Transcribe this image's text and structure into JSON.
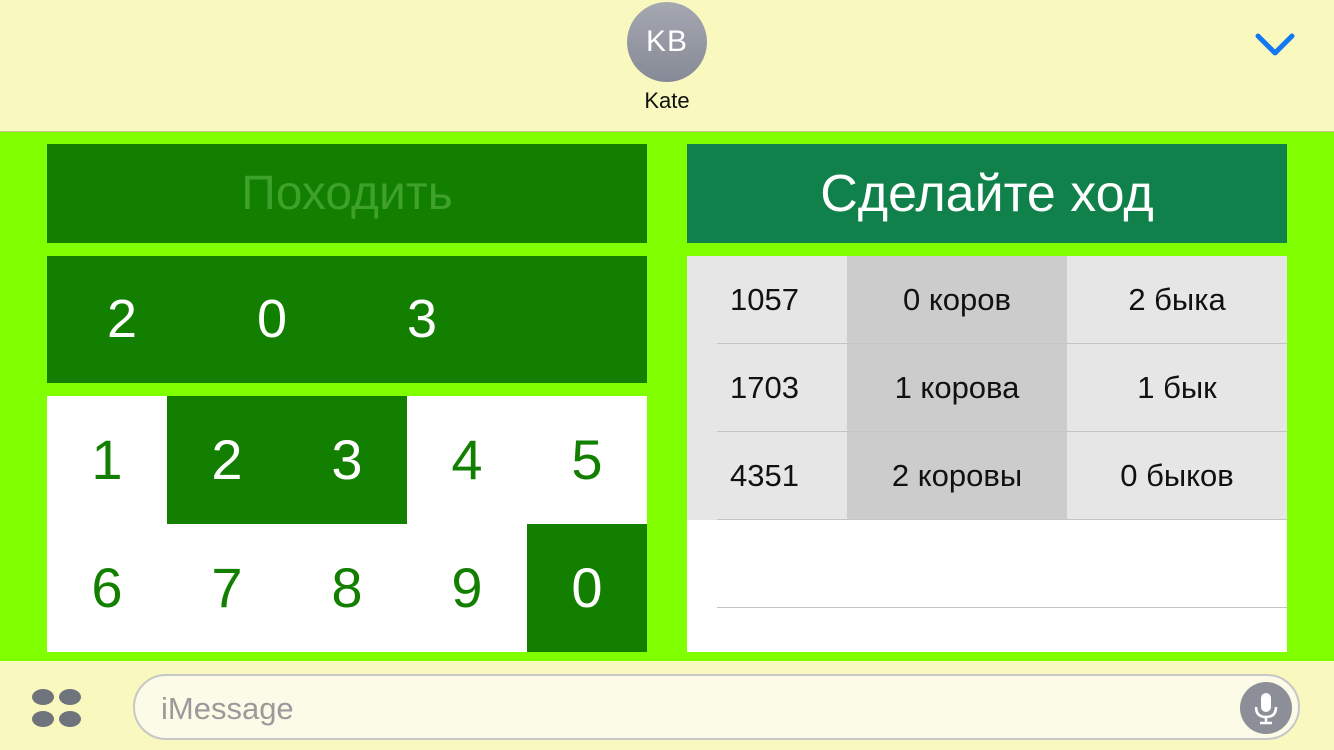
{
  "header": {
    "avatar_initials": "KB",
    "contact_name": "Kate",
    "collapse_icon": "chevron-down-icon",
    "accent_color": "#1478f5"
  },
  "game": {
    "move_button_label": "Походить",
    "status_banner": "Сделайте ход",
    "current_guess": [
      "2",
      "0",
      "3"
    ],
    "keypad": [
      {
        "digit": "1",
        "selected": false
      },
      {
        "digit": "2",
        "selected": true
      },
      {
        "digit": "3",
        "selected": true
      },
      {
        "digit": "4",
        "selected": false
      },
      {
        "digit": "5",
        "selected": false
      },
      {
        "digit": "6",
        "selected": false
      },
      {
        "digit": "7",
        "selected": false
      },
      {
        "digit": "8",
        "selected": false
      },
      {
        "digit": "9",
        "selected": false
      },
      {
        "digit": "0",
        "selected": true
      }
    ],
    "history": [
      {
        "number": "1057",
        "cows": "0 коров",
        "bulls": "2 быка"
      },
      {
        "number": "1703",
        "cows": "1 корова",
        "bulls": "1 бык"
      },
      {
        "number": "4351",
        "cows": "2 коровы",
        "bulls": "0 быков"
      }
    ],
    "colors": {
      "background": "#80ff00",
      "dark_green": "#127f00",
      "banner_green": "#10814b",
      "header_yellow": "#f8f8bf"
    }
  },
  "input_bar": {
    "placeholder": "iMessage",
    "apps_icon": "app-drawer-icon",
    "mic_icon": "microphone-icon"
  }
}
